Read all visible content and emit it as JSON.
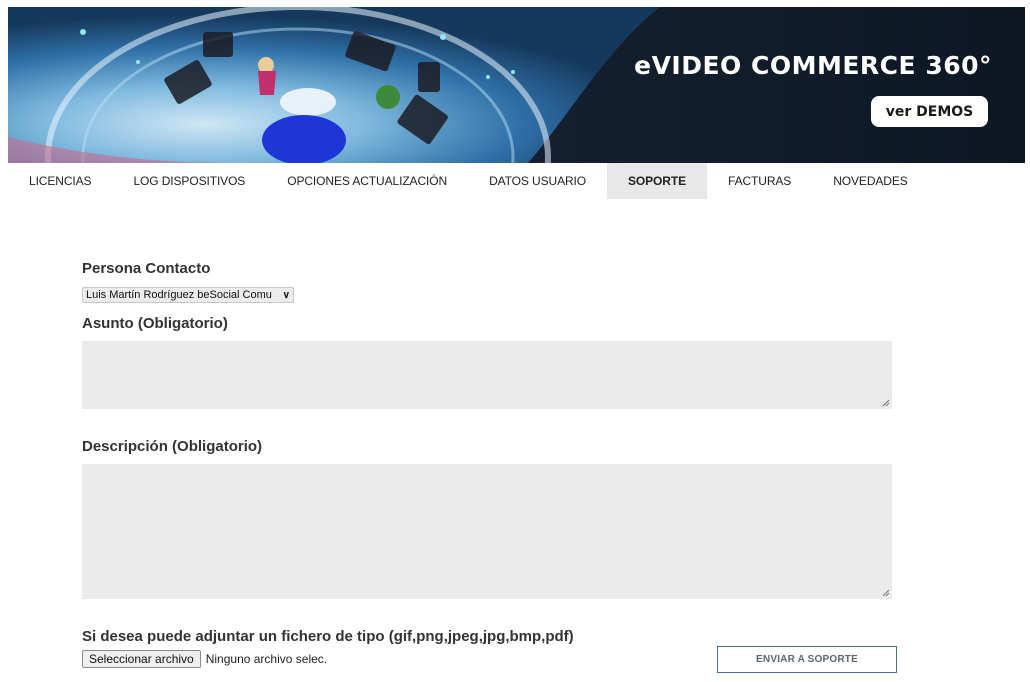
{
  "banner": {
    "title": "eVIDEO COMMERCE 360°",
    "button_label": "ver DEMOS"
  },
  "nav": {
    "tabs": [
      {
        "label": "LICENCIAS",
        "active": false
      },
      {
        "label": "LOG DISPOSITIVOS",
        "active": false
      },
      {
        "label": "OPCIONES ACTUALIZACIÓN",
        "active": false
      },
      {
        "label": "DATOS USUARIO",
        "active": false
      },
      {
        "label": "SOPORTE",
        "active": true
      },
      {
        "label": "FACTURAS",
        "active": false
      },
      {
        "label": "NOVEDADES",
        "active": false
      }
    ]
  },
  "form": {
    "contact_label": "Persona Contacto",
    "contact_selected": "Luis Martín Rodríguez beSocial Comu",
    "subject_label": "Asunto (Obligatorio)",
    "subject_value": "",
    "description_label": "Descripción (Obligatorio)",
    "description_value": "",
    "attach_label": "Si desea puede adjuntar un fichero de tipo (gif,png,jpeg,jpg,bmp,pdf)",
    "file_button": "Seleccionar archivo",
    "file_status": "Ninguno archivo selec.",
    "send_button": "ENVIAR A SOPORTE"
  },
  "colors": {
    "banner_bg": "#0f1b2a",
    "active_tab_bg": "#e8e8e8",
    "field_bg": "#ebebeb",
    "send_border": "#4a6e8a"
  }
}
